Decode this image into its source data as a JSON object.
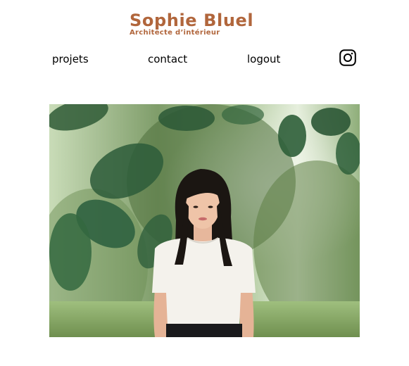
{
  "header": {
    "title": "Sophie Bluel",
    "subtitle": "Architecte d’intérieur"
  },
  "nav": {
    "items": [
      {
        "label": "projets"
      },
      {
        "label": "contact"
      },
      {
        "label": "logout"
      }
    ],
    "social_icon": "instagram-icon"
  },
  "colors": {
    "brand": "#B1663C",
    "text": "#000000",
    "background": "#FFFFFF"
  },
  "hero": {
    "image": "portrait-photo-woman-among-leaves"
  }
}
